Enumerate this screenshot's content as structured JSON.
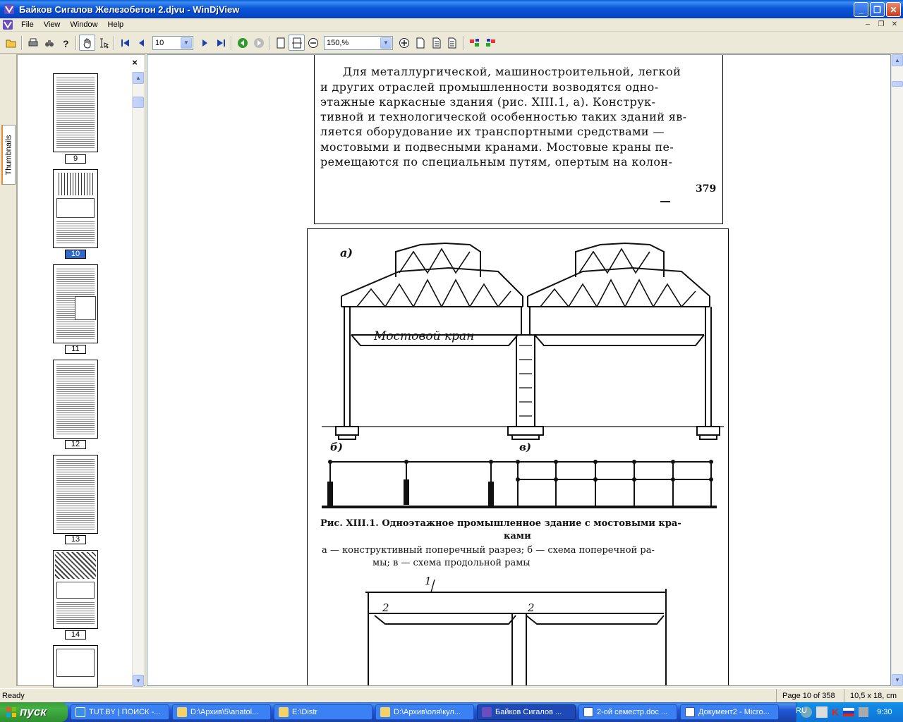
{
  "window": {
    "title": "Байков Сигалов Железобетон 2.djvu - WinDjView"
  },
  "menu": [
    "File",
    "View",
    "Window",
    "Help"
  ],
  "toolbar": {
    "page_value": "10",
    "zoom_value": "150,%"
  },
  "sidebar": {
    "tab_label": "Thumbnails",
    "close_label": "×",
    "thumbnails": [
      {
        "page": "9",
        "selected": false
      },
      {
        "page": "10",
        "selected": true
      },
      {
        "page": "11",
        "selected": false
      },
      {
        "page": "12",
        "selected": false
      },
      {
        "page": "13",
        "selected": false
      },
      {
        "page": "14",
        "selected": false
      }
    ]
  },
  "document": {
    "page_top": {
      "lines": [
        "Для металлургической, машиностроительной, легкой",
        "и других отраслей  промышленности возводятся  одно-",
        "этажные каркасные здания   (рис. XIII.1, а). Конструк-",
        "тивной и технологической особенностью таких зданий яв-",
        "ляется оборудование их транспортными  средствами —",
        "мостовыми и подвесными кранами. Мостовые краны пе-",
        "ремещаются по специальным путям, опертым на колон-"
      ],
      "page_number": "379"
    },
    "page_bottom": {
      "fig_label_a": "а)",
      "fig_label_b": "б)",
      "fig_label_v": "в)",
      "crane_label": "Мостовой кран",
      "caption_line1": "Рис. XIII.1. Одноэтажное промышленное здание с мостовыми кра-",
      "caption_line2": "ками",
      "subcaption_line1": "а — конструктивный поперечный разрез; б — схема поперечной ра-",
      "subcaption_line2": "мы; в — схема продольной рамы",
      "label_1": "1",
      "label_2a": "2",
      "label_2b": "2"
    }
  },
  "status": {
    "left": "Ready",
    "page_info": "Page 10 of 358",
    "size_info": "10,5 x 18, cm"
  },
  "taskbar": {
    "start_label": "пуск",
    "tasks": [
      "TUT.BY | ПОИСК -...",
      "D:\\Архив\\5\\anatol...",
      "E:\\Distr",
      "D:\\Архив\\оля\\кул...",
      "Байков Сигалов ...",
      "2-ой семестр.doc ...",
      "Документ2 - Micro..."
    ],
    "lang": "RU",
    "clock": "9:30"
  }
}
